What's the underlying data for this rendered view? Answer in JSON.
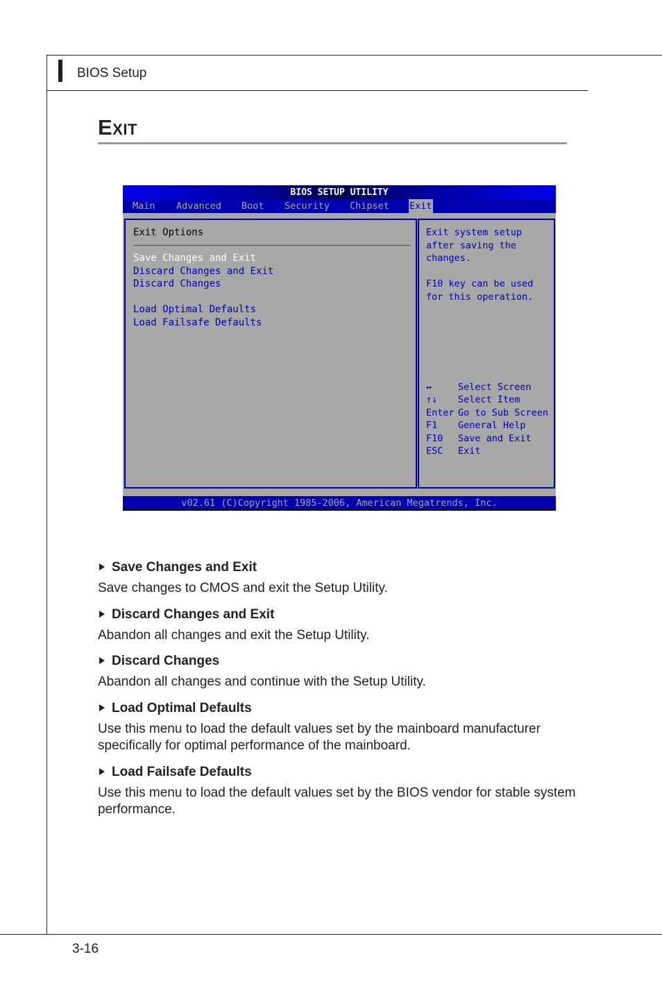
{
  "header": {
    "title": "BIOS Setup"
  },
  "section": {
    "title": "Exit"
  },
  "bios": {
    "title": "BIOS SETUP UTILITY",
    "tabs": [
      {
        "label": "Main",
        "active": false
      },
      {
        "label": "Advanced",
        "active": false
      },
      {
        "label": "Boot",
        "active": false
      },
      {
        "label": "Security",
        "active": false
      },
      {
        "label": "Chipset",
        "active": false
      },
      {
        "label": "Exit",
        "active": true
      }
    ],
    "left_panel": {
      "heading": "Exit Options",
      "options": [
        {
          "label": "Save Changes and Exit",
          "selected": true
        },
        {
          "label": "Discard Changes and Exit",
          "selected": false
        },
        {
          "label": "Discard Changes",
          "selected": false
        },
        {
          "label": "Load Optimal Defaults",
          "selected": false
        },
        {
          "label": "Load Failsafe Defaults",
          "selected": false
        }
      ]
    },
    "help_panel": {
      "lines": [
        "Exit system setup",
        "after saving the",
        "changes.",
        "",
        "F10 key can be used",
        "for this operation."
      ],
      "keys": [
        {
          "key": "↔",
          "desc": "Select Screen"
        },
        {
          "key": "↑↓",
          "desc": "Select Item"
        },
        {
          "key": "Enter",
          "desc": "Go to Sub Screen"
        },
        {
          "key": "F1",
          "desc": "General Help"
        },
        {
          "key": "F10",
          "desc": "Save and Exit"
        },
        {
          "key": "ESC",
          "desc": "Exit"
        }
      ]
    },
    "footer": "v02.61 (C)Copyright 1985-2006, American Megatrends, Inc.",
    "colors": {
      "background": "#a8a8a8",
      "blue": "#0000b0",
      "selected_text": "#ffffff"
    }
  },
  "descriptions": [
    {
      "title": "Save Changes and Exit",
      "body": "Save changes to CMOS and exit the Setup Utility."
    },
    {
      "title": "Discard Changes and Exit",
      "body": "Abandon all changes and exit the Setup Utility."
    },
    {
      "title": "Discard Changes",
      "body": "Abandon all changes and continue with the Setup Utility."
    },
    {
      "title": "Load Optimal Defaults",
      "body": "Use this menu to load the default values set by the mainboard manufacturer specifically for optimal performance of the mainboard."
    },
    {
      "title": "Load Failsafe Defaults",
      "body": "Use this menu to load the default values set by the BIOS vendor for stable system performance."
    }
  ],
  "footer": {
    "page_number": "3-16"
  }
}
